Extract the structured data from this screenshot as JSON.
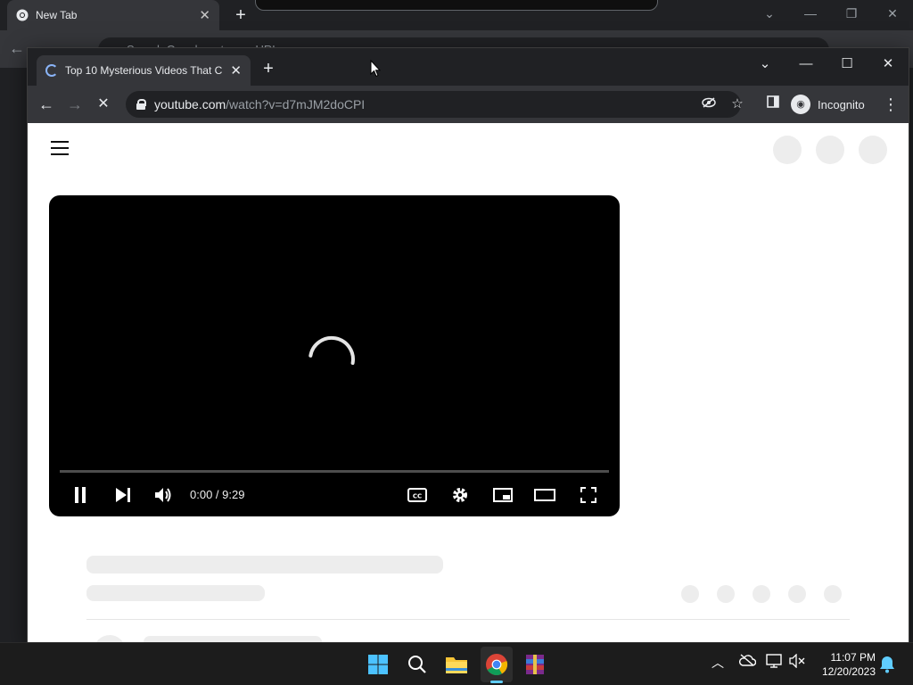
{
  "bg_browser": {
    "tab_title": "New Tab",
    "omnibox_placeholder": "Search Google or type a URL"
  },
  "browser": {
    "tab_title": "Top 10 Mysterious Videos That C",
    "url_host": "youtube.com",
    "url_path": "/watch?v=d7mJM2doCPI",
    "profile_label": "Incognito"
  },
  "player": {
    "time": "0:00 / 9:29",
    "progress_fraction": 0
  },
  "taskbar": {
    "time": "11:07 PM",
    "date": "12/20/2023"
  },
  "colors": {
    "youtube_player": "#000000",
    "skeleton": "#ededed",
    "taskbar_accent": "#60cdff"
  }
}
